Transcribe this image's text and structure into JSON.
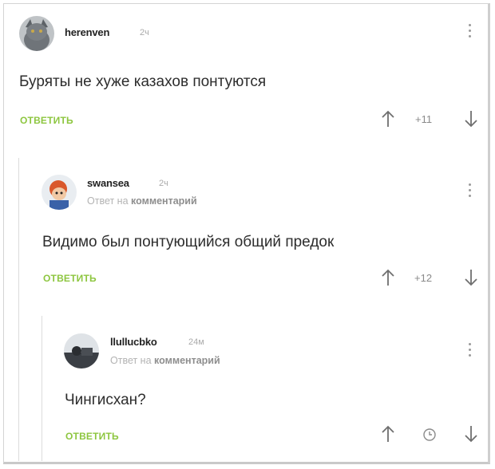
{
  "comments": [
    {
      "username": "herenven",
      "time": "2ч",
      "text": "Буряты не хуже казахов понтуются",
      "reply_label": "ОТВЕТИТЬ",
      "rating": "+11",
      "avatar_icon": "gray-cat-avatar"
    },
    {
      "username": "swansea",
      "time": "2ч",
      "reply_to_prefix": "Ответ на",
      "reply_to_link": "комментарий",
      "text": "Видимо был понтующийся общий предок",
      "reply_label": "ОТВЕТИТЬ",
      "rating": "+12",
      "avatar_icon": "cartoon-character-avatar"
    },
    {
      "username": "llullucbko",
      "time": "24м",
      "reply_to_prefix": "Ответ на",
      "reply_to_link": "комментарий",
      "text": "Чингисхан?",
      "reply_label": "ОТВЕТИТЬ",
      "rating_icon": "clock-icon",
      "avatar_icon": "dark-photo-avatar"
    }
  ],
  "colors": {
    "accent": "#8dc63f",
    "thread_line": "#dcdcdc",
    "muted": "#aaaaaa"
  }
}
